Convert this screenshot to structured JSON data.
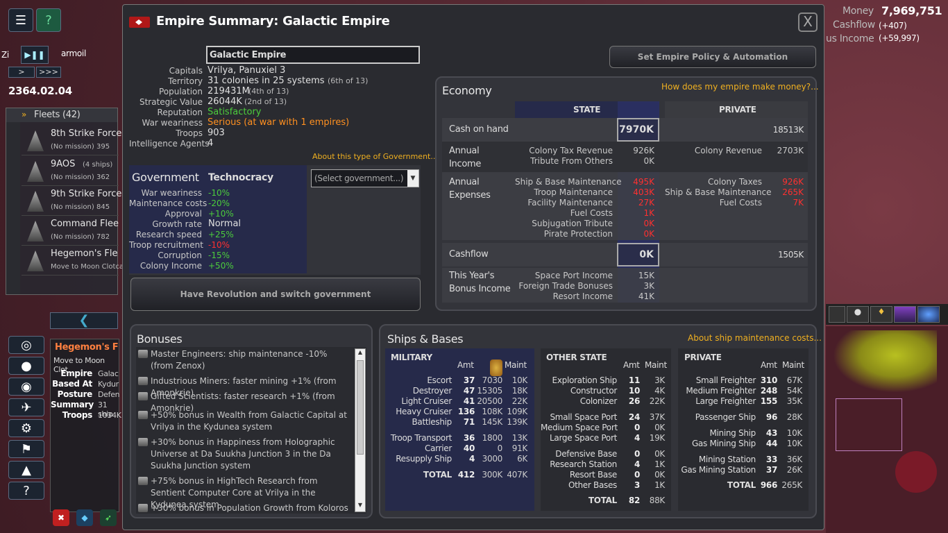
{
  "hud": {
    "money_label": "Money",
    "money_value": "7,969,751",
    "cashflow_label": "Cashflow",
    "cashflow_value": "(+407)",
    "bonus_income_label": "us Income",
    "bonus_income_value": "(+59,997)",
    "date": "2364.02.04",
    "speed_slow": ">",
    "speed_fast": ">>>",
    "map_text_left": "Zi",
    "map_text_turmoil": "armoil"
  },
  "fleets": {
    "header": "Fleets (42)",
    "items": [
      {
        "name": "8th Strike Force",
        "mission": "(No mission)",
        "extra": "395"
      },
      {
        "name": "9AOS",
        "ships": "(4 ships)",
        "mission": "(No mission)",
        "extra": "362"
      },
      {
        "name": "9th Strike Force",
        "mission": "(No mission)",
        "extra": "845"
      },
      {
        "name": "Command Flee",
        "mission": "(No mission)",
        "extra": "782"
      },
      {
        "name": "Hegemon's Fle",
        "mission": "Move to Moon Clotca",
        "extra": ""
      }
    ]
  },
  "selected": {
    "name": "Hegemon's F",
    "mission": "Move to Moon Clot",
    "rows": [
      {
        "label": "Empire",
        "value": "Galac"
      },
      {
        "label": "Based At",
        "value": "Kydur"
      },
      {
        "label": "Posture",
        "value": "Defen"
      },
      {
        "label": "Summary",
        "value": "31 ship"
      },
      {
        "label": "Troops",
        "value": "1034K"
      }
    ]
  },
  "window": {
    "title": "Empire Summary: Galactic Empire",
    "close": "X"
  },
  "empire": {
    "name_input": "Galactic Empire",
    "policy_button": "Set Empire Policy & Automation",
    "info": [
      {
        "label": "Capitals",
        "value": "Vrilya, Panuxiel 3",
        "note": "",
        "cls": ""
      },
      {
        "label": "Territory",
        "value": "31 colonies in 25 systems",
        "note": "(6th of 13)",
        "cls": ""
      },
      {
        "label": "Population",
        "value": "219431M",
        "note": "(4th of 13)",
        "cls": ""
      },
      {
        "label": "Strategic Value",
        "value": "26044K",
        "note": "(2nd of 13)",
        "cls": ""
      },
      {
        "label": "Reputation",
        "value": "Satisfactory",
        "note": "",
        "cls": "green"
      },
      {
        "label": "War weariness",
        "value": "Serious (at war with 1 empires)",
        "note": "",
        "cls": "orange"
      },
      {
        "label": "Troops",
        "value": "903",
        "note": "",
        "cls": ""
      },
      {
        "label": "Intelligence Agents",
        "value": "4",
        "note": "",
        "cls": ""
      }
    ],
    "gov_link": "About this type of Government...",
    "gov_header": "Government",
    "gov_type": "Technocracy",
    "gov_select": "(Select government...)",
    "gov_rows": [
      {
        "label": "War weariness",
        "value": "-10%",
        "cls": "green"
      },
      {
        "label": "Maintenance costs",
        "value": "-20%",
        "cls": "green"
      },
      {
        "label": "Approval",
        "value": "+10%",
        "cls": "green"
      },
      {
        "label": "Growth rate",
        "value": "Normal",
        "cls": ""
      },
      {
        "label": "Research speed",
        "value": "+25%",
        "cls": "green"
      },
      {
        "label": "Troop recruitment",
        "value": "-10%",
        "cls": "red"
      },
      {
        "label": "Corruption",
        "value": "-15%",
        "cls": "green"
      },
      {
        "label": "Colony Income",
        "value": "+50%",
        "cls": "green"
      }
    ],
    "revolution_button": "Have Revolution and switch government"
  },
  "economy": {
    "header": "Economy",
    "link": "How does my empire make money?...",
    "col_state": "STATE",
    "col_private": "PRIVATE",
    "cash_label": "Cash on hand",
    "cash_state": "7970K",
    "cash_private": "18513K",
    "annual_income_label": "Annual Income",
    "income_state": [
      {
        "label": "Colony Tax Revenue",
        "value": "926K"
      },
      {
        "label": "Tribute From Others",
        "value": "0K"
      }
    ],
    "income_private": [
      {
        "label": "Colony Revenue",
        "value": "2703K"
      }
    ],
    "annual_expenses_label": "Annual Expenses",
    "expenses_state": [
      {
        "label": "Ship & Base Maintenance",
        "value": "495K"
      },
      {
        "label": "Troop Maintenance",
        "value": "403K"
      },
      {
        "label": "Facility Maintenance",
        "value": "27K"
      },
      {
        "label": "Fuel Costs",
        "value": "1K"
      },
      {
        "label": "Subjugation Tribute",
        "value": "0K"
      },
      {
        "label": "Pirate Protection",
        "value": "0K"
      }
    ],
    "expenses_private": [
      {
        "label": "Colony Taxes",
        "value": "926K"
      },
      {
        "label": "Ship & Base Maintenance",
        "value": "265K"
      },
      {
        "label": "Fuel Costs",
        "value": "7K"
      }
    ],
    "cashflow_label": "Cashflow",
    "cashflow_state": "0K",
    "cashflow_private": "1505K",
    "bonus_label": "This Year's Bonus Income",
    "bonus_state": [
      {
        "label": "Space Port Income",
        "value": "15K"
      },
      {
        "label": "Foreign Trade Bonuses",
        "value": "3K"
      },
      {
        "label": "Resort Income",
        "value": "41K"
      }
    ]
  },
  "bonuses": {
    "header": "Bonuses",
    "items": [
      "Master Engineers: ship maintenance -10% (from Zenox)",
      "Industrious Miners: faster mining +1% (from Amonkrie)",
      "Gifted Scientists: faster research +1% (from Amonkrie)",
      "+50% bonus in Wealth from Galactic Capital at Vrilya in the Kydunea system",
      "+30% bonus in Happiness from Holographic Universe at Da Suukha Junction 3 in the Da Suukha Junction system",
      "+75% bonus in HighTech Research from Sentient Computer Core at Vrilya in the Kydunea system",
      "+30% bonus in Population Growth from Koloros"
    ]
  },
  "ships": {
    "header": "Ships & Bases",
    "link": "About ship maintenance costs...",
    "amt": "Amt",
    "maint": "Maint",
    "military_header": "MILITARY",
    "military": [
      {
        "label": "Escort",
        "amt": "37",
        "cost": "7030",
        "maint": "10K"
      },
      {
        "label": "Destroyer",
        "amt": "47",
        "cost": "15305",
        "maint": "18K"
      },
      {
        "label": "Light Cruiser",
        "amt": "41",
        "cost": "20500",
        "maint": "22K"
      },
      {
        "label": "Heavy Cruiser",
        "amt": "136",
        "cost": "108K",
        "maint": "109K"
      },
      {
        "label": "Battleship",
        "amt": "71",
        "cost": "145K",
        "maint": "139K"
      },
      {
        "label": "Troop Transport",
        "amt": "36",
        "cost": "1800",
        "maint": "13K"
      },
      {
        "label": "Carrier",
        "amt": "40",
        "cost": "0",
        "maint": "91K"
      },
      {
        "label": "Resupply Ship",
        "amt": "4",
        "cost": "3000",
        "maint": "6K"
      },
      {
        "label": "TOTAL",
        "amt": "412",
        "cost": "300K",
        "maint": "407K"
      }
    ],
    "other_header": "OTHER STATE",
    "other": [
      {
        "label": "Exploration Ship",
        "amt": "11",
        "maint": "3K"
      },
      {
        "label": "Constructor",
        "amt": "10",
        "maint": "4K"
      },
      {
        "label": "Colonizer",
        "amt": "26",
        "maint": "22K"
      },
      {
        "label": "Small Space Port",
        "amt": "24",
        "maint": "37K"
      },
      {
        "label": "Medium Space Port",
        "amt": "0",
        "maint": "0K"
      },
      {
        "label": "Large Space Port",
        "amt": "4",
        "maint": "19K"
      },
      {
        "label": "Defensive Base",
        "amt": "0",
        "maint": "0K"
      },
      {
        "label": "Research Station",
        "amt": "4",
        "maint": "1K"
      },
      {
        "label": "Resort Base",
        "amt": "0",
        "maint": "0K"
      },
      {
        "label": "Other Bases",
        "amt": "3",
        "maint": "1K"
      },
      {
        "label": "TOTAL",
        "amt": "82",
        "maint": "88K"
      }
    ],
    "private_header": "PRIVATE",
    "private": [
      {
        "label": "Small Freighter",
        "amt": "310",
        "maint": "67K"
      },
      {
        "label": "Medium Freighter",
        "amt": "248",
        "maint": "54K"
      },
      {
        "label": "Large Freighter",
        "amt": "155",
        "maint": "35K"
      },
      {
        "label": "Passenger Ship",
        "amt": "96",
        "maint": "28K"
      },
      {
        "label": "Mining Ship",
        "amt": "43",
        "maint": "10K"
      },
      {
        "label": "Gas Mining Ship",
        "amt": "44",
        "maint": "10K"
      },
      {
        "label": "Mining Station",
        "amt": "33",
        "maint": "36K"
      },
      {
        "label": "Gas Mining Station",
        "amt": "37",
        "maint": "26K"
      },
      {
        "label": "TOTAL",
        "amt": "966",
        "maint": "265K"
      }
    ]
  },
  "colors": {
    "accent_gold": "#f0b020",
    "positive": "#4ccc3c",
    "negative": "#ff3030",
    "warning": "#ff9020"
  }
}
